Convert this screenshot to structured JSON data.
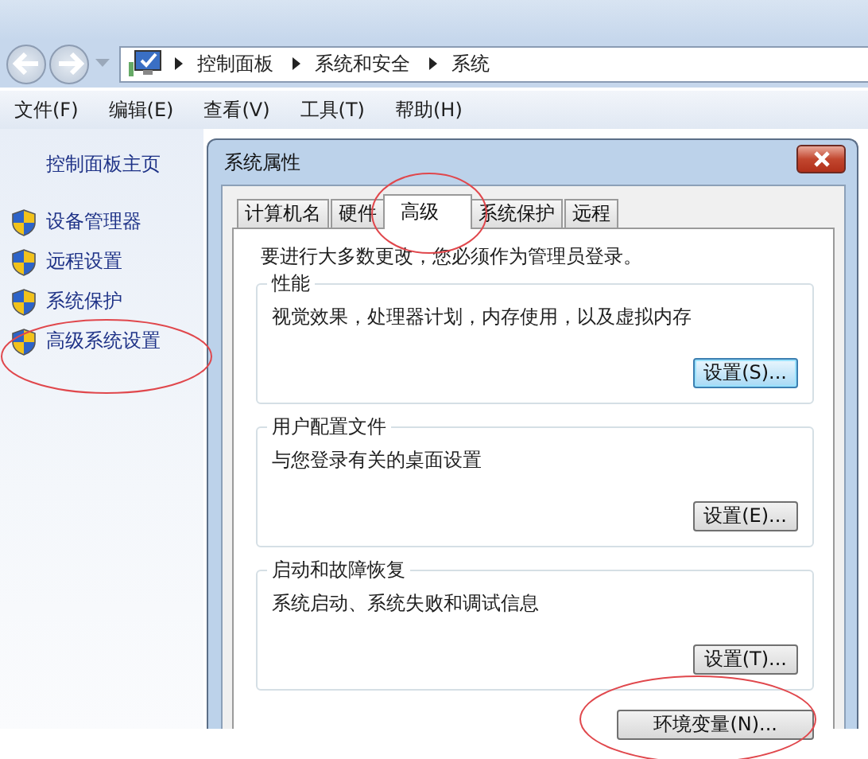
{
  "address_bar": {
    "breadcrumbs": [
      "控制面板",
      "系统和安全",
      "系统"
    ]
  },
  "menu": [
    "文件(F)",
    "编辑(E)",
    "查看(V)",
    "工具(T)",
    "帮助(H)"
  ],
  "sidebar": {
    "home_link": "控制面板主页",
    "items": [
      {
        "label": "设备管理器",
        "circled": false
      },
      {
        "label": "远程设置",
        "circled": false
      },
      {
        "label": "系统保护",
        "circled": false
      },
      {
        "label": "高级系统设置",
        "circled": true
      }
    ]
  },
  "dialog": {
    "title": "系统属性",
    "tabs": [
      {
        "label": "计算机名",
        "selected": false,
        "circled": false
      },
      {
        "label": "硬件",
        "selected": false,
        "circled": false
      },
      {
        "label": "高级",
        "selected": true,
        "circled": true
      },
      {
        "label": "系统保护",
        "selected": false,
        "circled": false
      },
      {
        "label": "远程",
        "selected": false,
        "circled": false
      }
    ],
    "notice": "要进行大多数更改，您必须作为管理员登录。",
    "groups": [
      {
        "title": "性能",
        "description": "视觉效果，处理器计划，内存使用，以及虚拟内存",
        "button": {
          "label": "设置(S)...",
          "focused": true
        }
      },
      {
        "title": "用户配置文件",
        "description": "与您登录有关的桌面设置",
        "button": {
          "label": "设置(E)...",
          "focused": false
        }
      },
      {
        "title": "启动和故障恢复",
        "description": "系统启动、系统失败和调试信息",
        "button": {
          "label": "设置(T)...",
          "focused": false
        }
      }
    ],
    "env_button": {
      "label": "环境变量(N)...",
      "circled": true
    }
  }
}
